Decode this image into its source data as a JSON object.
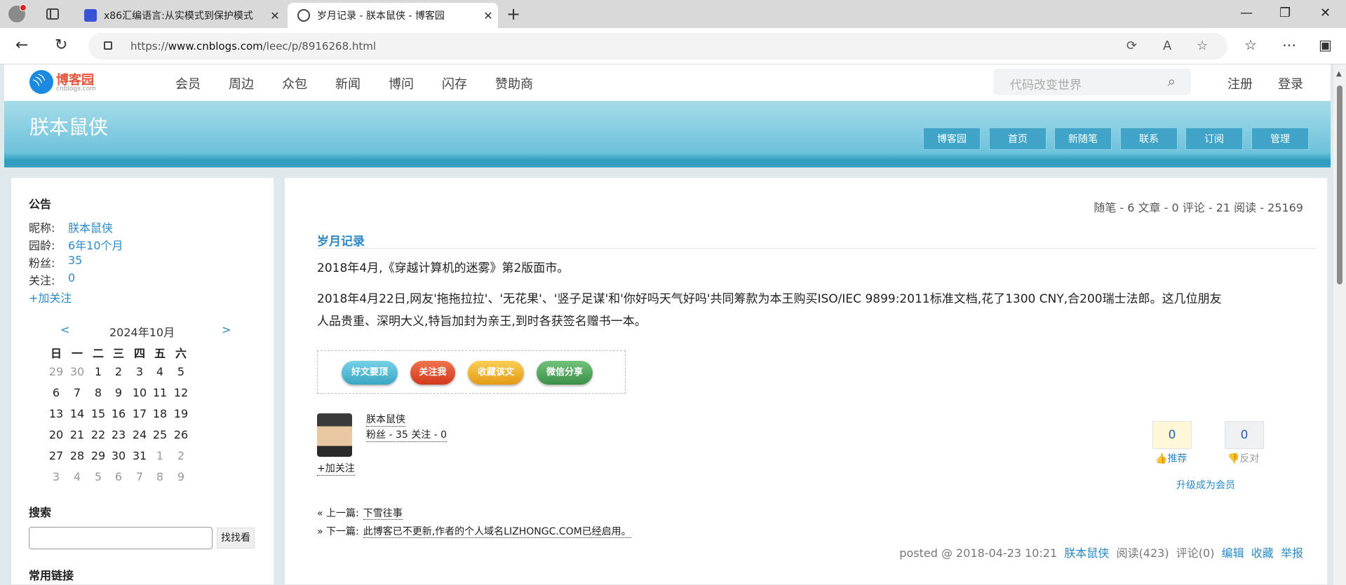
{
  "browser": {
    "tabs": [
      {
        "title": "x86汇编语言:从实模式到保护模式",
        "close": "✕"
      },
      {
        "title": "岁月记录 - 朕本鼠侠 - 博客园",
        "close": "✕"
      }
    ],
    "new_tab": "+",
    "url_prefix": "https://",
    "url_host": "www.cnblogs.com",
    "url_path": "/leec/p/8916268.html",
    "window_buttons": {
      "minimize": "—",
      "restore": "❐",
      "close": "✕"
    }
  },
  "site": {
    "logo_text": "博客园",
    "logo_sub": "cnblogs.com",
    "nav": [
      "会员",
      "周边",
      "众包",
      "新闻",
      "博问",
      "闪存",
      "赞助商"
    ],
    "search_placeholder": "代码改变世界",
    "register": "注册",
    "login": "登录"
  },
  "blog": {
    "title": "朕本鼠侠",
    "nav": [
      "博客园",
      "首页",
      "新随笔",
      "联系",
      "订阅",
      "管理"
    ]
  },
  "sidebar": {
    "notice_heading": "公告",
    "info": [
      {
        "label": "昵称:",
        "value": "朕本鼠侠"
      },
      {
        "label": "园龄:",
        "value": "6年10个月"
      },
      {
        "label": "粉丝:",
        "value": "35"
      },
      {
        "label": "关注:",
        "value": "0"
      }
    ],
    "follow": "+加关注",
    "calendar": {
      "prev": "<",
      "next": ">",
      "title": "2024年10月",
      "weekdays": [
        "日",
        "一",
        "二",
        "三",
        "四",
        "五",
        "六"
      ],
      "weeks": [
        [
          "29",
          "30",
          "1",
          "2",
          "3",
          "4",
          "5"
        ],
        [
          "6",
          "7",
          "8",
          "9",
          "10",
          "11",
          "12"
        ],
        [
          "13",
          "14",
          "15",
          "16",
          "17",
          "18",
          "19"
        ],
        [
          "20",
          "21",
          "22",
          "23",
          "24",
          "25",
          "26"
        ],
        [
          "27",
          "28",
          "29",
          "30",
          "31",
          "1",
          "2"
        ],
        [
          "3",
          "4",
          "5",
          "6",
          "7",
          "8",
          "9"
        ]
      ]
    },
    "search_heading": "搜索",
    "search_button": "找找看",
    "links_heading": "常用链接"
  },
  "main": {
    "stats": "随笔 - 6  文章 - 0  评论 - 21  阅读 - 25169",
    "post_title": "岁月记录",
    "paragraphs": [
      "2018年4月,《穿越计算机的迷雾》第2版面市。",
      "2018年4月22日,网友'拖拖拉拉'、'无花果'、'竖子足谋'和'你好吗天气好吗'共同筹款为本王购买ISO/IEC 9899:2011标准文档,花了1300 CNY,合200瑞士法郎。这几位朋友",
      "人品贵重、深明大义,特旨加封为亲王,到时各获签名赠书一本。"
    ],
    "share_buttons": [
      "好文要顶",
      "关注我",
      "收藏该文",
      "微信分享"
    ],
    "author": {
      "name": "朕本鼠侠",
      "stats": "粉丝 - 35 关注 - 0",
      "follow": "+加关注"
    },
    "votes": {
      "up_count": "0",
      "up_label": "推荐",
      "down_count": "0",
      "down_label": "反对"
    },
    "upgrade": "升级成为会员",
    "prev": {
      "label": "« 上一篇:",
      "title": "下雪往事"
    },
    "next": {
      "label": "» 下一篇:",
      "title": "此博客已不更新,作者的个人域名LIZHONGC.COM已经启用。"
    },
    "postinfo": {
      "posted": "posted @ 2018-04-23 10:21",
      "author": "朕本鼠侠",
      "reads": "阅读(423)",
      "comments": "评论(0)",
      "edit": "编辑",
      "collect": "收藏",
      "report": "举报"
    }
  }
}
